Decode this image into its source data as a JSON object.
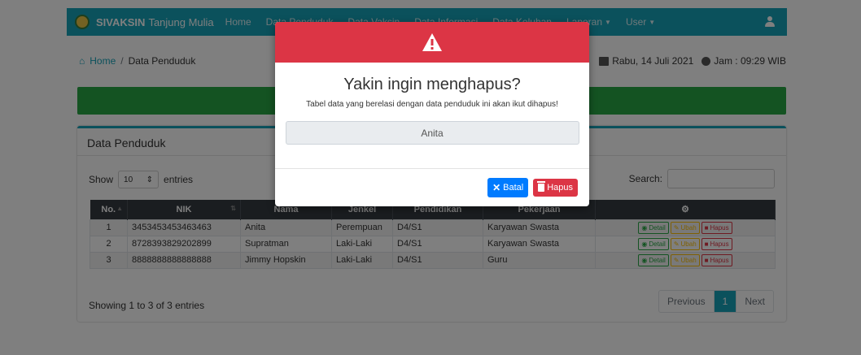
{
  "navbar": {
    "brand": "SIVAKSIN",
    "brand_sub": "Tanjung Mulia",
    "items": [
      {
        "label": "Home",
        "dropdown": false
      },
      {
        "label": "Data Penduduk",
        "dropdown": false
      },
      {
        "label": "Data Vaksin",
        "dropdown": false
      },
      {
        "label": "Data Informasi",
        "dropdown": false
      },
      {
        "label": "Data Keluhan",
        "dropdown": false
      },
      {
        "label": "Laporan",
        "dropdown": true
      },
      {
        "label": "User",
        "dropdown": true
      }
    ],
    "user_icon": "user-icon"
  },
  "breadcrumb": {
    "home": "Home",
    "separator": "/",
    "current": "Data Penduduk"
  },
  "datebar": {
    "date": "Rabu, 14 Juli 2021",
    "time": "Jam : 09:29 WIB"
  },
  "card": {
    "title": "Data Penduduk",
    "show_label": "Show",
    "entries_value": "10",
    "entries_label": "entries",
    "search_label": "Search:",
    "columns": [
      "No.",
      "NIK",
      "Nama",
      "Jenkel",
      "Pendidikan",
      "Pekerjaan",
      "action-gear-icon"
    ],
    "rows": [
      {
        "no": "1",
        "nik": "3453453453463463",
        "nama": "Anita",
        "jenkel": "Perempuan",
        "pendidikan": "D4/S1",
        "pekerjaan": "Karyawan Swasta"
      },
      {
        "no": "2",
        "nik": "8728393829202899",
        "nama": "Supratman",
        "jenkel": "Laki-Laki",
        "pendidikan": "D4/S1",
        "pekerjaan": "Karyawan Swasta"
      },
      {
        "no": "3",
        "nik": "8888888888888888",
        "nama": "Jimmy Hopskin",
        "jenkel": "Laki-Laki",
        "pendidikan": "D4/S1",
        "pekerjaan": "Guru"
      }
    ],
    "row_actions": {
      "detail": "Detail",
      "ubah": "Ubah",
      "hapus": "Hapus"
    },
    "info": "Showing 1 to 3 of 3 entries",
    "pagination": {
      "previous": "Previous",
      "current": "1",
      "next": "Next"
    }
  },
  "modal": {
    "icon": "warning-triangle-icon",
    "title": "Yakin ingin menghapus?",
    "description": "Tabel data yang berelasi dengan data penduduk ini akan ikut dihapus!",
    "name_value": "Anita",
    "cancel_label": "Batal",
    "confirm_label": "Hapus"
  },
  "colors": {
    "navbar": "#17a2b8",
    "modal_header": "#dc3545",
    "success_bar": "#28a745",
    "cancel_button": "#007bff",
    "confirm_button": "#dc3545"
  }
}
